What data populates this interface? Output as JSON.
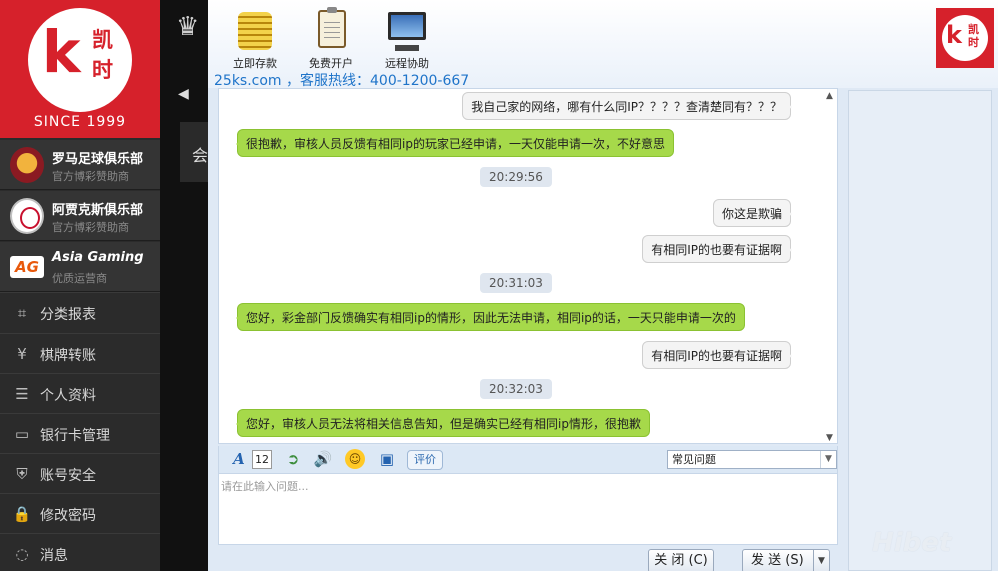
{
  "brand": {
    "logo_k": "k",
    "logo_zh_1": "凯",
    "logo_zh_2": "时",
    "since": "SINCE 1999"
  },
  "sponsors": [
    {
      "name": "罗马足球俱乐部",
      "sub": "官方博彩赞助商",
      "icon": "roma-badge-icon"
    },
    {
      "name": "阿贾克斯俱乐部",
      "sub": "官方博彩赞助商",
      "icon": "ajax-badge-icon"
    },
    {
      "name": "Asia Gaming",
      "sub": "优质运营商",
      "icon": "ag-logo-icon",
      "badge": "AG"
    }
  ],
  "menu": [
    {
      "label": "分类报表",
      "icon": "report-icon",
      "glyph": "⌗"
    },
    {
      "label": "棋牌转账",
      "icon": "yen-transfer-icon",
      "glyph": "¥"
    },
    {
      "label": "个人资料",
      "icon": "profile-icon",
      "glyph": "☰"
    },
    {
      "label": "银行卡管理",
      "icon": "bank-card-icon",
      "glyph": "▭"
    },
    {
      "label": "账号安全",
      "icon": "shield-icon",
      "glyph": "⛨"
    },
    {
      "label": "修改密码",
      "icon": "lock-icon",
      "glyph": "🔒"
    },
    {
      "label": "消息",
      "icon": "message-icon",
      "glyph": "◌"
    }
  ],
  "background": {
    "hui": "会"
  },
  "toolbar": {
    "deposit": "立即存款",
    "register": "免费开户",
    "remote": "远程协助",
    "hotline": "25ks.com ，客服热线：400-1200-667"
  },
  "messages": [
    {
      "type": "me",
      "text": "我自己家的网络，哪有什么同IP？？？？查清楚同有？？？"
    },
    {
      "type": "agent",
      "text": "很抱歉，审核人员反馈有相同ip的玩家已经申请，一天仅能申请一次，不好意思"
    },
    {
      "type": "time",
      "text": "20:29:56"
    },
    {
      "type": "me",
      "text": "你这是欺骗"
    },
    {
      "type": "me",
      "text": "有相同IP的也要有证据啊"
    },
    {
      "type": "time",
      "text": "20:31:03"
    },
    {
      "type": "agent",
      "text": "您好，彩金部门反馈确实有相同ip的情形，因此无法申请，相同ip的话，一天只能申请一次的"
    },
    {
      "type": "me",
      "text": "有相同IP的也要有证据啊"
    },
    {
      "type": "time",
      "text": "20:32:03"
    },
    {
      "type": "agent",
      "text": "您好，审核人员无法将相关信息告知，但是确实已经有相同ip情形，很抱歉"
    }
  ],
  "input_toolbar": {
    "font_size": "12",
    "rate": "评价",
    "faq_selected": "常见问题"
  },
  "input": {
    "placeholder": "请在此输入问题..."
  },
  "buttons": {
    "close": "关 闭 (C)",
    "send": "发 送 (S)"
  },
  "watermark": "Hibet"
}
